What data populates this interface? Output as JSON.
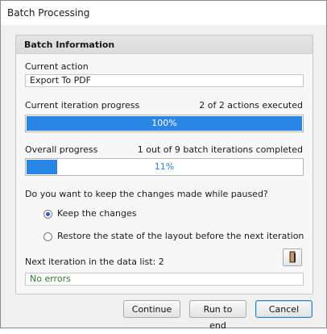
{
  "window": {
    "title": "Batch Processing"
  },
  "group": {
    "title": "Batch Information"
  },
  "current_action": {
    "label": "Current action",
    "value": "Export To PDF"
  },
  "iteration_progress": {
    "label": "Current iteration progress",
    "status": "2 of 2 actions executed",
    "percent_text": "100%",
    "fraction": 1.0
  },
  "overall_progress": {
    "label": "Overall progress",
    "status": "1 out of 9 batch iterations completed",
    "percent_text": "11%",
    "fraction": 0.11
  },
  "question": "Do you want to keep the changes made while paused?",
  "options": [
    {
      "label": "Keep the changes",
      "checked": true
    },
    {
      "label": "Restore the state of the layout before the next iteration",
      "checked": false
    }
  ],
  "next_iteration": {
    "label": "Next iteration in the data list: 2",
    "icon": "document-icon"
  },
  "status_field": {
    "value": "No errors"
  },
  "buttons": {
    "continue": "Continue",
    "run_to_end": "Run to end",
    "cancel": "Cancel"
  },
  "colors": {
    "progress_fill": "#2a86e5",
    "success_text": "#2e7d32",
    "percent_text_light": "#2a86e5"
  }
}
